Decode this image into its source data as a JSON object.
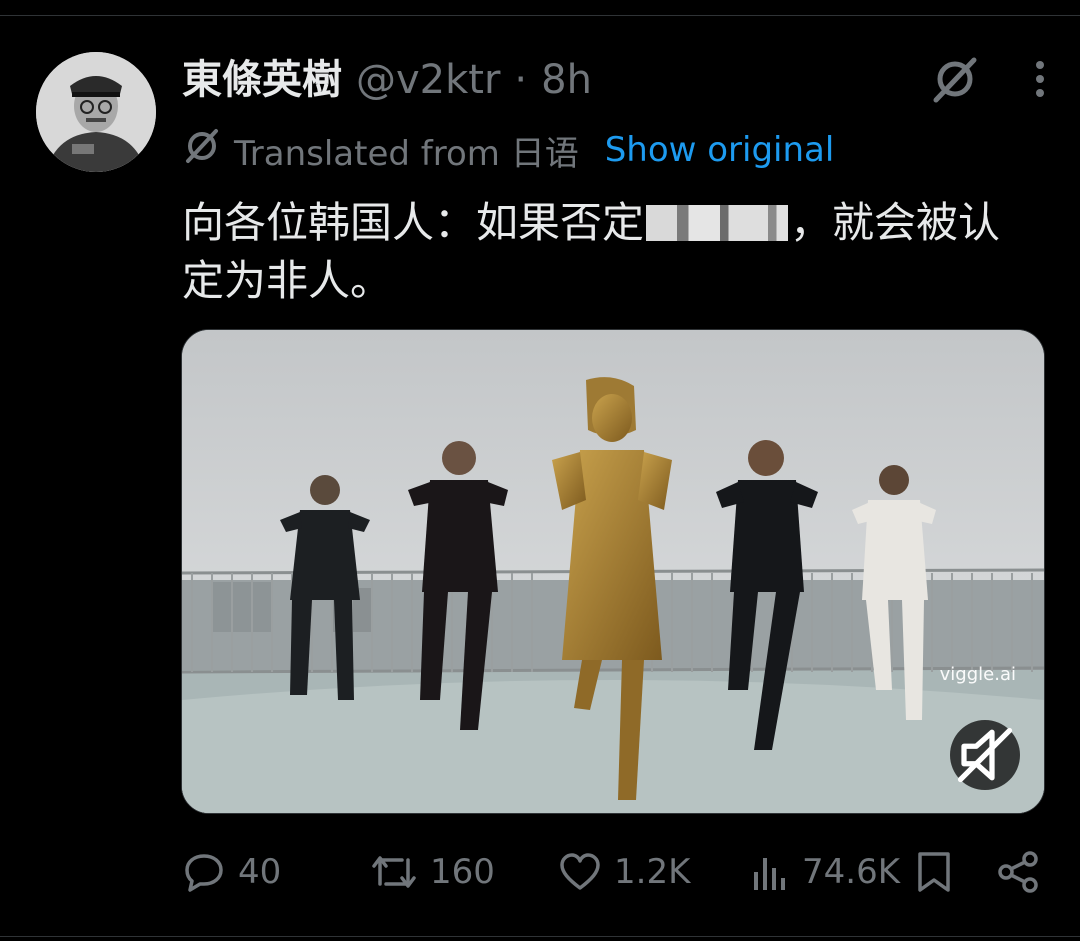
{
  "tweet": {
    "display_name": "東條英樹",
    "handle": "@v2ktr",
    "separator": "·",
    "time": "8h",
    "translation": {
      "label": "Translated from 日语",
      "show_original": "Show original"
    },
    "text_before_redaction": "向各位韩国人：如果否定",
    "text_after_redaction": "，就会被认定为非人。",
    "media": {
      "watermark": "viggle.ai",
      "muted": true
    },
    "stats": {
      "replies": "40",
      "reposts": "160",
      "likes": "1.2K",
      "views": "74.6K"
    }
  },
  "colors": {
    "background": "#000000",
    "text": "#e7e9ea",
    "secondary": "#71767b",
    "link": "#1d9bf0"
  },
  "icons": [
    "grok-slash-icon",
    "more-options-icon",
    "translate-icon",
    "reply-icon",
    "repost-icon",
    "like-icon",
    "views-icon",
    "bookmark-icon",
    "share-icon",
    "mute-icon"
  ]
}
